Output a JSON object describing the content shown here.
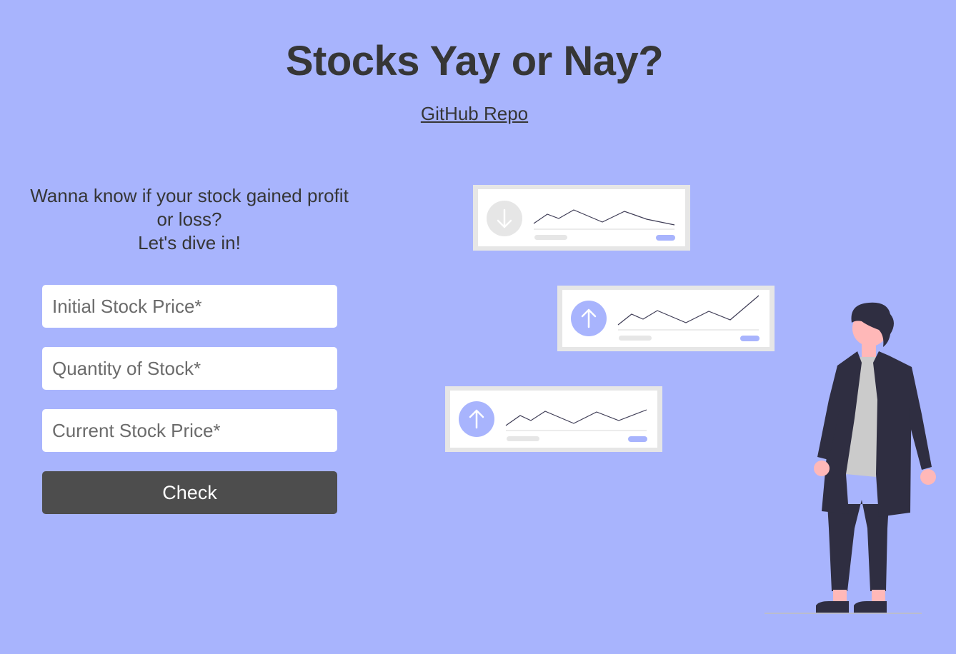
{
  "header": {
    "title": "Stocks Yay or Nay?",
    "repo_link": "GitHub Repo"
  },
  "intro": {
    "line1": "Wanna know if your stock gained profit",
    "line2": "or loss?",
    "line3": "Let's dive in!"
  },
  "form": {
    "initial_price_placeholder": "Initial Stock Price*",
    "quantity_placeholder": "Quantity of Stock*",
    "current_price_placeholder": "Current Stock Price*",
    "check_label": "Check"
  },
  "illustration": {
    "cards": [
      {
        "trend": "down",
        "icon": "arrow-down-icon"
      },
      {
        "trend": "up",
        "icon": "arrow-up-icon"
      },
      {
        "trend": "up",
        "icon": "arrow-up-icon"
      }
    ]
  },
  "colors": {
    "background": "#a8b4fd",
    "button": "#4d4d4d",
    "accent": "#a8b4fd",
    "figure_dark": "#2f2e41",
    "skin": "#ffb8b8"
  }
}
